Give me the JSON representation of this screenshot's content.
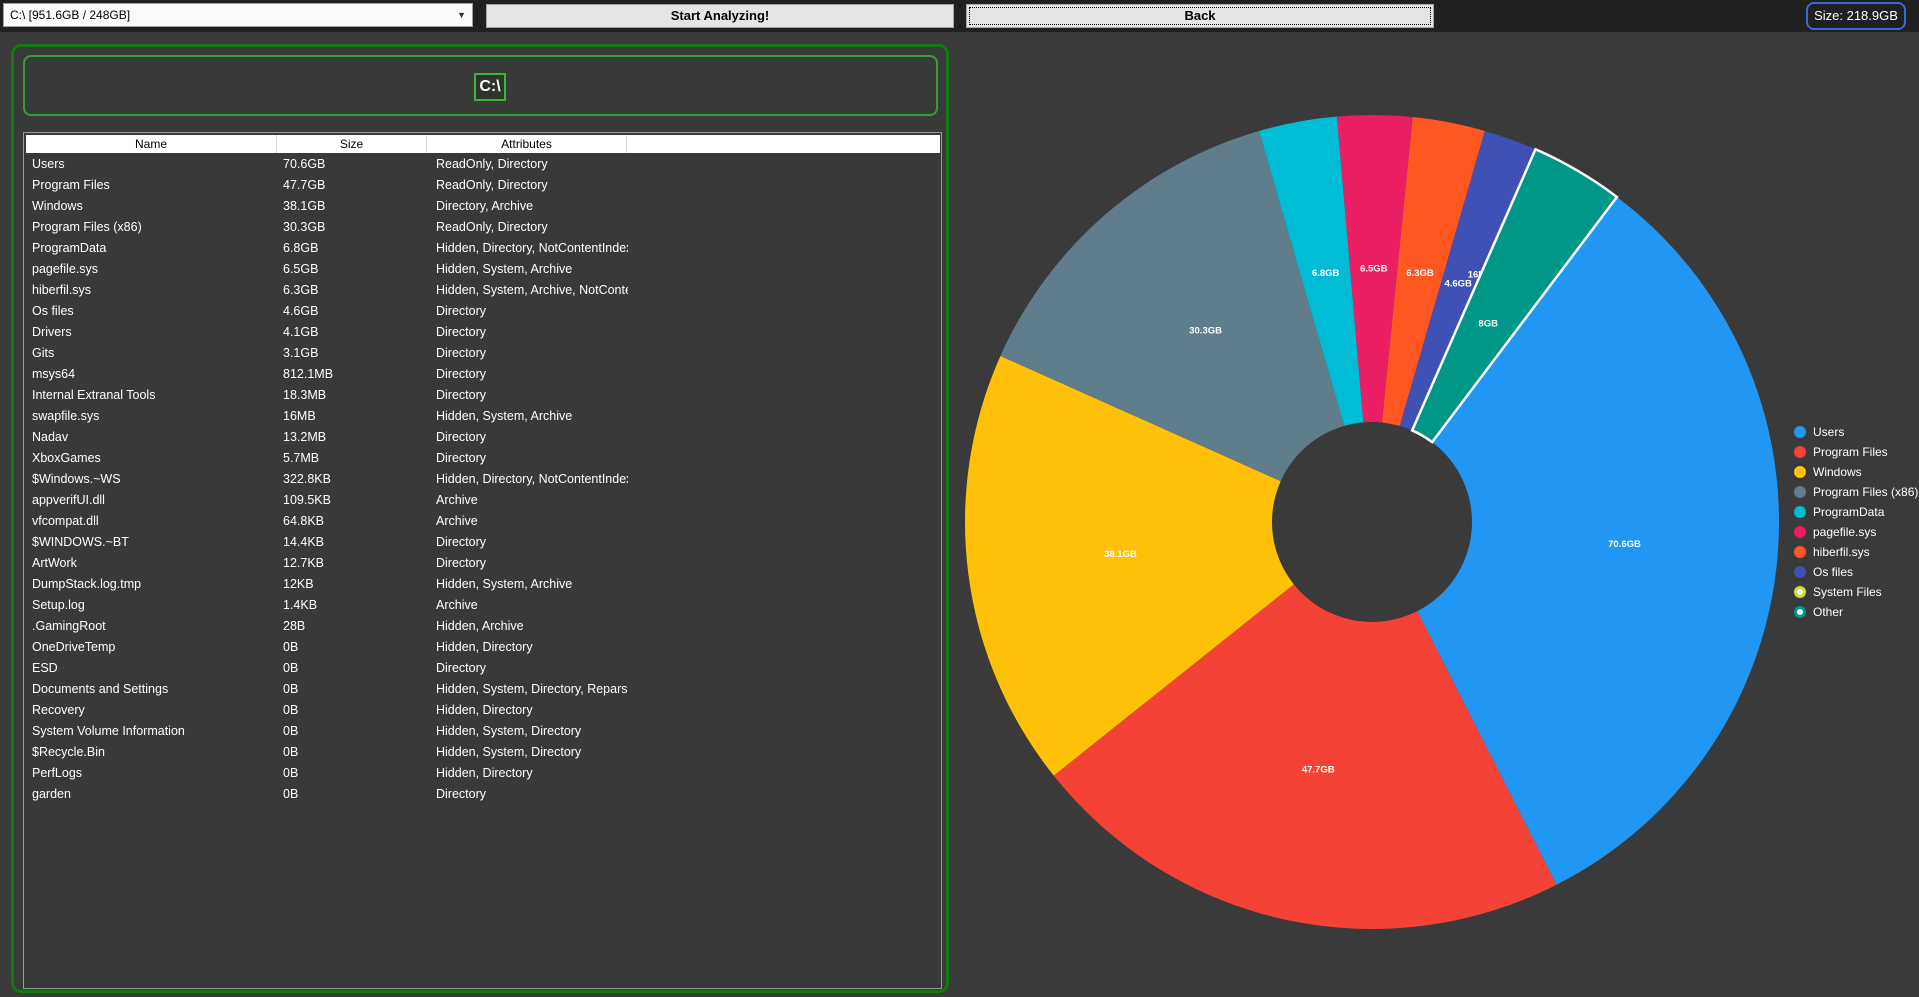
{
  "toolbar": {
    "drive_value": "C:\\ [951.6GB / 248GB]",
    "analyze_label": "Start Analyzing!",
    "back_label": "Back",
    "size_label": "Size: 218.9GB"
  },
  "panel": {
    "drive_icon_text": "C:\\"
  },
  "table": {
    "columns": [
      "Name",
      "Size",
      "Attributes"
    ],
    "rows": [
      {
        "name": "Users",
        "size": "70.6GB",
        "attributes": "ReadOnly, Directory"
      },
      {
        "name": "Program Files",
        "size": "47.7GB",
        "attributes": "ReadOnly, Directory"
      },
      {
        "name": "Windows",
        "size": "38.1GB",
        "attributes": "Directory, Archive"
      },
      {
        "name": "Program Files (x86)",
        "size": "30.3GB",
        "attributes": "ReadOnly, Directory"
      },
      {
        "name": "ProgramData",
        "size": "6.8GB",
        "attributes": "Hidden, Directory, NotContentIndexed"
      },
      {
        "name": "pagefile.sys",
        "size": "6.5GB",
        "attributes": "Hidden, System, Archive"
      },
      {
        "name": "hiberfil.sys",
        "size": "6.3GB",
        "attributes": "Hidden, System, Archive, NotContentIndexed"
      },
      {
        "name": "Os files",
        "size": "4.6GB",
        "attributes": "Directory"
      },
      {
        "name": "Drivers",
        "size": "4.1GB",
        "attributes": "Directory"
      },
      {
        "name": "Gits",
        "size": "3.1GB",
        "attributes": "Directory"
      },
      {
        "name": "msys64",
        "size": "812.1MB",
        "attributes": "Directory"
      },
      {
        "name": "Internal Extranal Tools",
        "size": "18.3MB",
        "attributes": "Directory"
      },
      {
        "name": "swapfile.sys",
        "size": "16MB",
        "attributes": "Hidden, System, Archive"
      },
      {
        "name": "Nadav",
        "size": "13.2MB",
        "attributes": "Directory"
      },
      {
        "name": "XboxGames",
        "size": "5.7MB",
        "attributes": "Directory"
      },
      {
        "name": "$Windows.~WS",
        "size": "322.8KB",
        "attributes": "Hidden, Directory, NotContentIndexed"
      },
      {
        "name": "appverifUI.dll",
        "size": "109.5KB",
        "attributes": "Archive"
      },
      {
        "name": "vfcompat.dll",
        "size": "64.8KB",
        "attributes": "Archive"
      },
      {
        "name": "$WINDOWS.~BT",
        "size": "14.4KB",
        "attributes": "Directory"
      },
      {
        "name": "ArtWork",
        "size": "12.7KB",
        "attributes": "Directory"
      },
      {
        "name": "DumpStack.log.tmp",
        "size": "12KB",
        "attributes": "Hidden, System, Archive"
      },
      {
        "name": "Setup.log",
        "size": "1.4KB",
        "attributes": "Archive"
      },
      {
        "name": ".GamingRoot",
        "size": "28B",
        "attributes": "Hidden, Archive"
      },
      {
        "name": "OneDriveTemp",
        "size": "0B",
        "attributes": "Hidden, Directory"
      },
      {
        "name": "ESD",
        "size": "0B",
        "attributes": "Directory"
      },
      {
        "name": "Documents and Settings",
        "size": "0B",
        "attributes": "Hidden, System, Directory, ReparsePoint"
      },
      {
        "name": "Recovery",
        "size": "0B",
        "attributes": "Hidden, Directory"
      },
      {
        "name": "System Volume Information",
        "size": "0B",
        "attributes": "Hidden, System, Directory"
      },
      {
        "name": "$Recycle.Bin",
        "size": "0B",
        "attributes": "Hidden, System, Directory"
      },
      {
        "name": "PerfLogs",
        "size": "0B",
        "attributes": "Hidden, Directory"
      },
      {
        "name": "garden",
        "size": "0B",
        "attributes": "Directory"
      }
    ]
  },
  "chart_data": {
    "type": "pie",
    "donut": true,
    "legend_position": "right",
    "slices": [
      {
        "name": "Users",
        "value": 70.6,
        "label": "70.6GB",
        "color": "#2196f3"
      },
      {
        "name": "Program Files",
        "value": 47.7,
        "label": "47.7GB",
        "color": "#f44336"
      },
      {
        "name": "Windows",
        "value": 38.1,
        "label": "38.1GB",
        "color": "#ffc107"
      },
      {
        "name": "Program Files (x86)",
        "value": 30.3,
        "label": "30.3GB",
        "color": "#607d8b"
      },
      {
        "name": "ProgramData",
        "value": 6.8,
        "label": "6.8GB",
        "color": "#00bcd4"
      },
      {
        "name": "pagefile.sys",
        "value": 6.5,
        "label": "6.5GB",
        "color": "#e91e63"
      },
      {
        "name": "hiberfil.sys",
        "value": 6.3,
        "label": "6.3GB",
        "color": "#ff5722"
      },
      {
        "name": "Os files",
        "value": 4.6,
        "label": "4.6GB",
        "color": "#3f51b5"
      },
      {
        "name": "System Files",
        "value": 0.016,
        "label": "16MB",
        "color": "#cddc39"
      },
      {
        "name": "Other",
        "value": 8.1,
        "label": "8GB",
        "color": "#009688"
      }
    ]
  }
}
